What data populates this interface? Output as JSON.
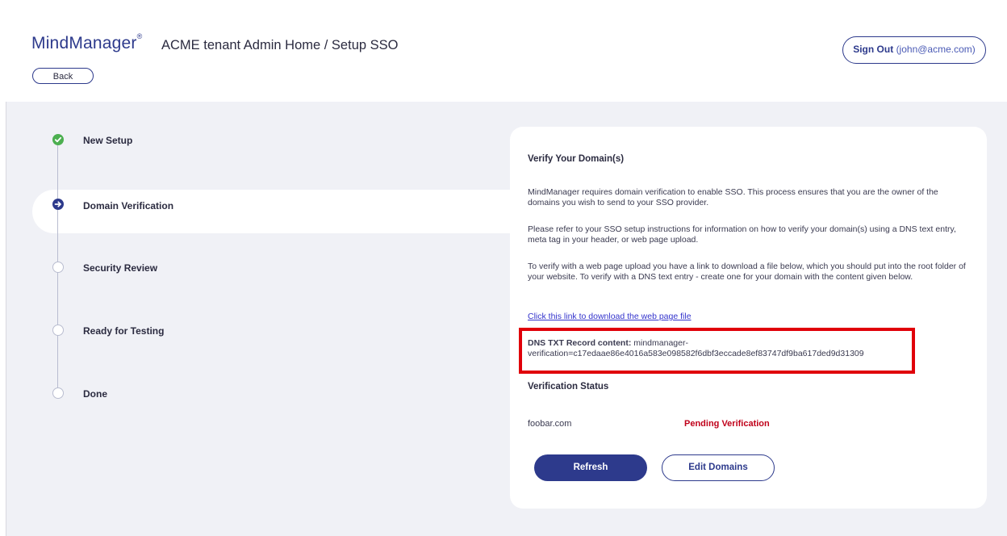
{
  "header": {
    "logo_text": "MindManager",
    "logo_mark": "®",
    "breadcrumb": "ACME tenant Admin Home / Setup SSO",
    "back_label": "Back",
    "signout_label": "Sign Out",
    "signout_user": "(john@acme.com)"
  },
  "steps": [
    {
      "label": "New Setup",
      "state": "done"
    },
    {
      "label": "Domain Verification",
      "state": "current"
    },
    {
      "label": "Security Review",
      "state": "todo"
    },
    {
      "label": "Ready for Testing",
      "state": "todo"
    },
    {
      "label": "Done",
      "state": "todo"
    }
  ],
  "panel": {
    "title": "Verify Your Domain(s)",
    "para1": "MindManager requires domain verification to enable SSO. This process ensures that you are the owner of the domains you wish to send to your SSO provider.",
    "para2": "Please refer to your SSO setup instructions for information on how to verify your domain(s) using a DNS text entry, meta tag in your header, or web page upload.",
    "para3": "To verify with a web page upload you have a link to download a file below, which you should put into the root folder of your website. To verify with a DNS text entry - create one for your domain with the content given below.",
    "download_link": "Click this link to download the web page file",
    "dns_label": "DNS TXT Record content:",
    "dns_value": "mindmanager-verification=c17edaae86e4016a583e098582f6dbf3eccade8ef83747df9ba617ded9d31309",
    "status_title": "Verification Status",
    "domain": "foobar.com",
    "status": "Pending Verification",
    "refresh_label": "Refresh",
    "edit_label": "Edit Domains"
  },
  "colors": {
    "brand": "#2d3a8c",
    "success": "#4caf50",
    "pending": "#c0001a",
    "highlight_border": "#e0000a",
    "background": "#f0f1f6"
  }
}
